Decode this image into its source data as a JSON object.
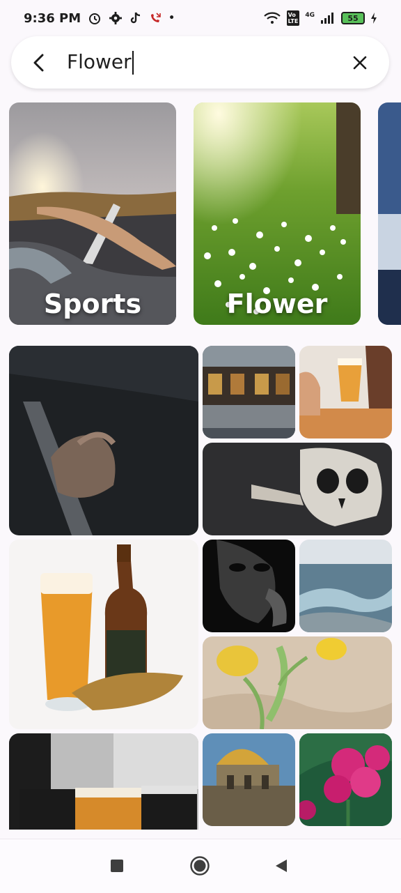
{
  "status_bar": {
    "time": "9:36 PM",
    "battery": "55",
    "network": "4G",
    "icons": [
      "alarm-icon",
      "gear-icon",
      "tiktok-icon",
      "missed-call-icon",
      "wifi-icon",
      "volte-icon",
      "signal-icon",
      "battery-icon",
      "charging-icon"
    ]
  },
  "search": {
    "query": "Flower",
    "back_icon": "back-arrow-icon",
    "clear_icon": "close-icon"
  },
  "categories": [
    {
      "label": "Sports"
    },
    {
      "label": "Flower"
    },
    {
      "label": ""
    }
  ],
  "gallery": {
    "tiles": [
      "hands-on-railing",
      "cafe-street",
      "beer-glass-thumbs-up",
      "skull-and-bones",
      "beer-bottle-and-glass",
      "dark-face-portrait",
      "ocean-waves",
      "yellow-tulips-on-paper",
      "beer-glasses-bar",
      "dome-of-the-rock",
      "pink-flowers"
    ]
  },
  "nav_bar": {
    "icons": [
      "recents-square-icon",
      "home-circle-icon",
      "back-triangle-icon"
    ]
  }
}
